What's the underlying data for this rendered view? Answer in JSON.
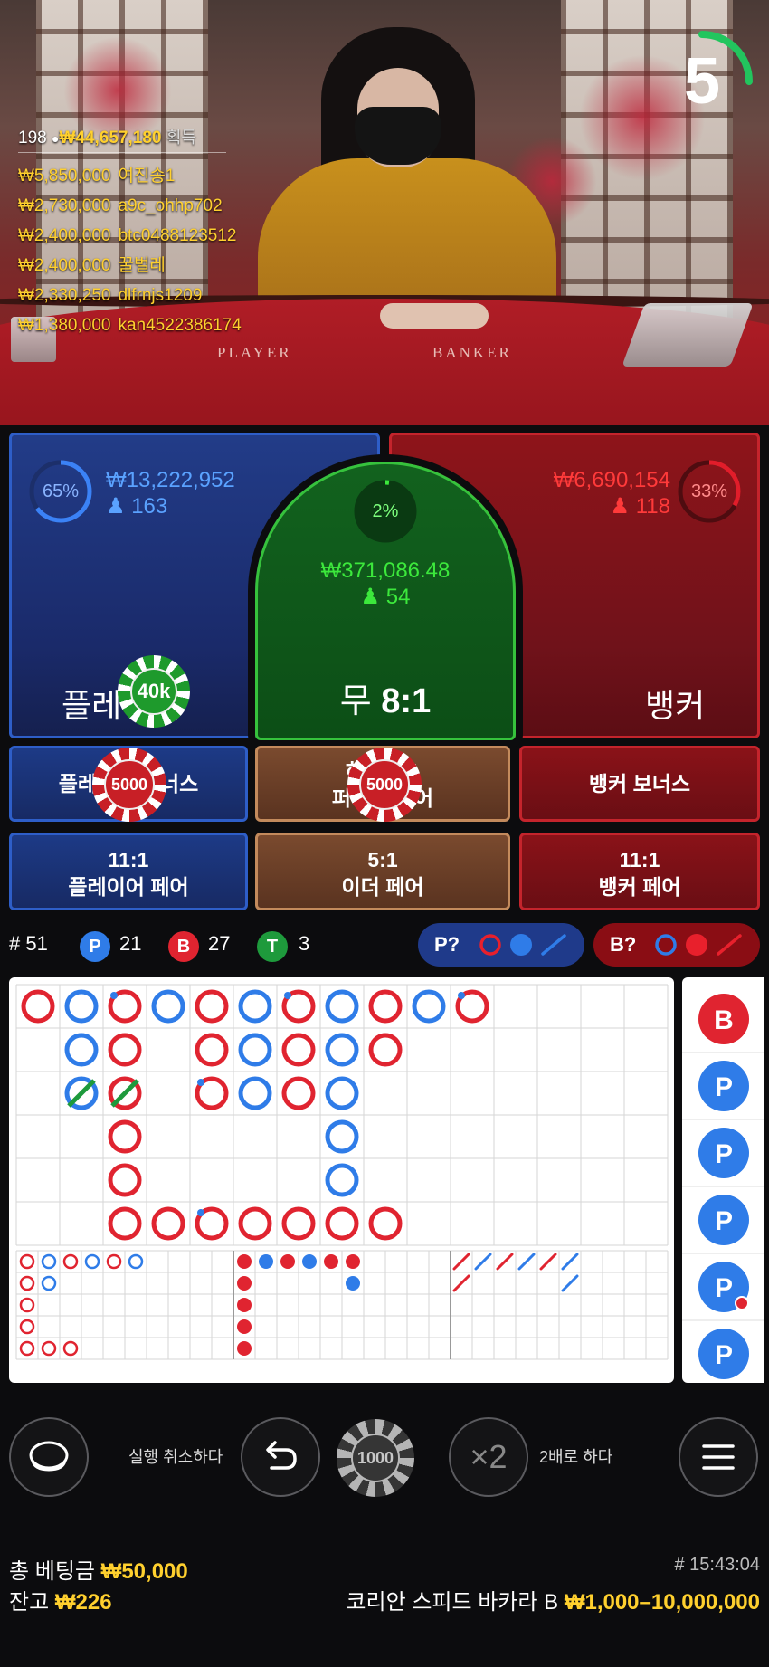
{
  "timer": {
    "seconds": "5",
    "progress": 0.25,
    "color": "#22c55e"
  },
  "video": {
    "felt_player": "PLAYER",
    "felt_banker": "BANKER",
    "players_count": "198",
    "total_won": "₩44,657,180",
    "won_label": "획득",
    "winners": [
      {
        "amount": "₩5,850,000",
        "name": "여진송1"
      },
      {
        "amount": "₩2,730,000",
        "name": "a9c_ohhp702"
      },
      {
        "amount": "₩2,400,000",
        "name": "btc0488123512"
      },
      {
        "amount": "₩2,400,000",
        "name": "꿀벌레"
      },
      {
        "amount": "₩2,330,250",
        "name": "dlfrnjs1209"
      },
      {
        "amount": "₩1,380,000",
        "name": "kan4522386174"
      }
    ]
  },
  "bets": {
    "player": {
      "label": "플레이어",
      "amount": "₩13,222,952",
      "count": "163",
      "percent": "65%",
      "ratio": 0.65,
      "color": "#3b82f6"
    },
    "banker": {
      "label": "뱅커",
      "amount": "₩6,690,154",
      "count": "118",
      "percent": "33%",
      "ratio": 0.33,
      "color": "#e11d2a"
    },
    "tie": {
      "label": "무",
      "odds": "8:1",
      "amount": "₩371,086.48",
      "count": "54",
      "percent": "2%",
      "ratio": 0.02,
      "color": "#3ce83c"
    },
    "player_bonus": "플레이어 보너스",
    "tie_bonus_line1": "하이 1:1",
    "tie_bonus_line2": "퍼펙트 페어",
    "banker_bonus": "뱅커 보너스",
    "player_pair_odds": "11:1",
    "player_pair": "플레이어 페어",
    "either_pair_odds": "5:1",
    "either_pair": "이더 페어",
    "banker_pair_odds": "11:1",
    "banker_pair": "뱅커 페어",
    "chips": {
      "player": "40k",
      "player_bonus": "5000",
      "tie_bonus": "5000"
    }
  },
  "stats": {
    "round": "# 51",
    "p_letter": "P",
    "p_count": "21",
    "b_letter": "B",
    "b_count": "27",
    "t_letter": "T",
    "t_count": "3",
    "p_ask": "P?",
    "b_ask": "B?"
  },
  "roadmap": {
    "big_road": [
      [
        "B",
        "P",
        "B*",
        "P",
        "B",
        "P",
        "B*",
        "P",
        "B",
        "P",
        "B*"
      ],
      [
        null,
        "P",
        "B",
        null,
        "B",
        "P",
        "B",
        "P",
        "B",
        null,
        null
      ],
      [
        null,
        "P/",
        "B/",
        null,
        "B*",
        "P",
        "B",
        "P",
        null,
        null,
        null
      ],
      [
        null,
        null,
        "B",
        null,
        null,
        null,
        null,
        "P",
        null,
        null,
        null
      ],
      [
        null,
        null,
        "B",
        null,
        null,
        null,
        null,
        "P",
        null,
        null,
        null
      ],
      [
        null,
        null,
        "B",
        "B",
        "B*",
        "B",
        "B",
        "B",
        "B",
        null,
        null
      ]
    ],
    "bead": [
      "B",
      "P",
      "P",
      "P",
      "P*",
      "P"
    ]
  },
  "controls": {
    "undo_label": "실행 취소하다",
    "chip_value": "1000",
    "double_icon": "×2",
    "double_label": "2배로 하다"
  },
  "footer": {
    "total_bet_label": "총 베팅금",
    "total_bet": "₩50,000",
    "balance_label": "잔고",
    "balance": "₩226",
    "game_id": "# 15:43:04",
    "table_name": "코리안 스피드 바카라 B",
    "limits": "₩1,000–10,000,000"
  }
}
